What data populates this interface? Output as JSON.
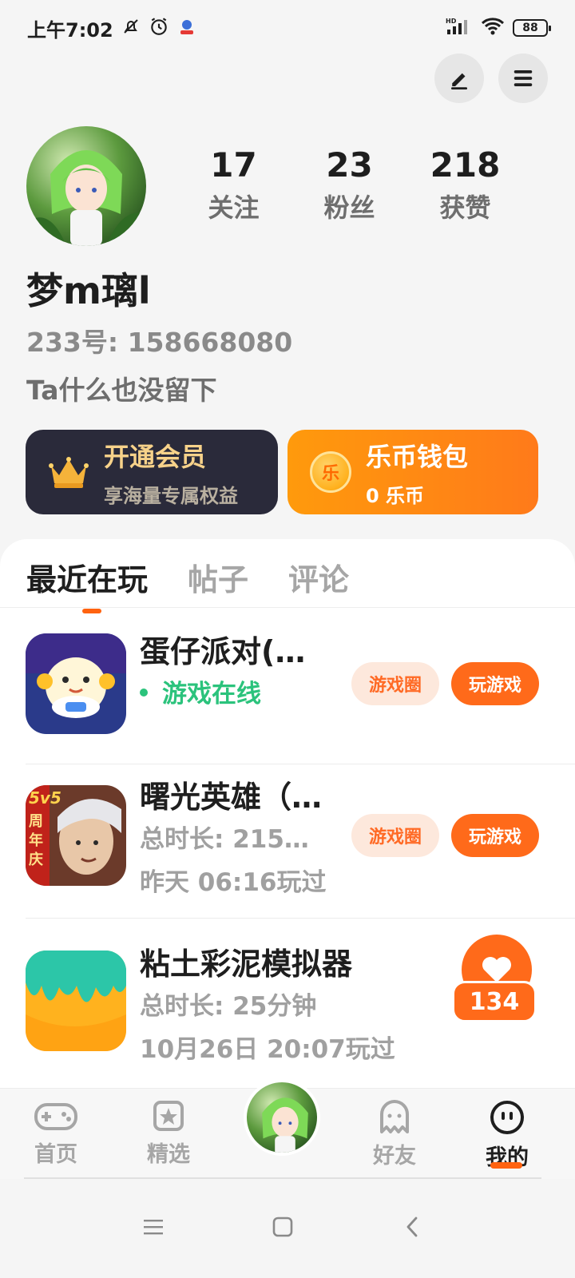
{
  "status_bar": {
    "time": "上午7:02",
    "battery": "88",
    "network": "HD"
  },
  "profile": {
    "stats": [
      {
        "value": "17",
        "label": "关注"
      },
      {
        "value": "23",
        "label": "粉丝"
      },
      {
        "value": "218",
        "label": "获赞"
      }
    ],
    "nickname": "梦m璃l",
    "account_id": "233号: 158668080",
    "bio": "Ta什么也没留下"
  },
  "cards": {
    "vip": {
      "title": "开通会员",
      "subtitle": "享海量专属权益"
    },
    "wallet": {
      "title": "乐币钱包",
      "subtitle": "0 乐币",
      "coin_glyph": "乐"
    }
  },
  "tabs": [
    {
      "label": "最近在玩",
      "active": true
    },
    {
      "label": "帖子",
      "active": false
    },
    {
      "label": "评论",
      "active": false
    }
  ],
  "games": [
    {
      "title": "蛋仔派对(…",
      "status": "游戏在线",
      "circle_label": "游戏圈",
      "play_label": "玩游戏"
    },
    {
      "title": "曙光英雄（…",
      "duration": "总时长: 215…",
      "last_played": "昨天 06:16玩过",
      "circle_label": "游戏圈",
      "play_label": "玩游戏",
      "icon_badge": "5v5",
      "icon_banner": "周年庆"
    },
    {
      "title": "粘土彩泥模拟器",
      "duration": "总时长: 25分钟",
      "last_played": "10月26日 20:07玩过"
    }
  ],
  "like_badge": {
    "count": "134"
  },
  "bottom_nav": [
    {
      "label": "首页",
      "icon": "gamepad-icon",
      "active": false
    },
    {
      "label": "精选",
      "icon": "star-icon",
      "active": false
    },
    {
      "label": "",
      "icon": "avatar",
      "active": false
    },
    {
      "label": "好友",
      "icon": "ghost-icon",
      "active": false
    },
    {
      "label": "我的",
      "icon": "face-icon",
      "active": true
    }
  ],
  "colors": {
    "accent": "#ff6a1a",
    "online": "#2bc37c",
    "vip_card": "#2a2a3a",
    "vip_text": "#f7d28a"
  }
}
